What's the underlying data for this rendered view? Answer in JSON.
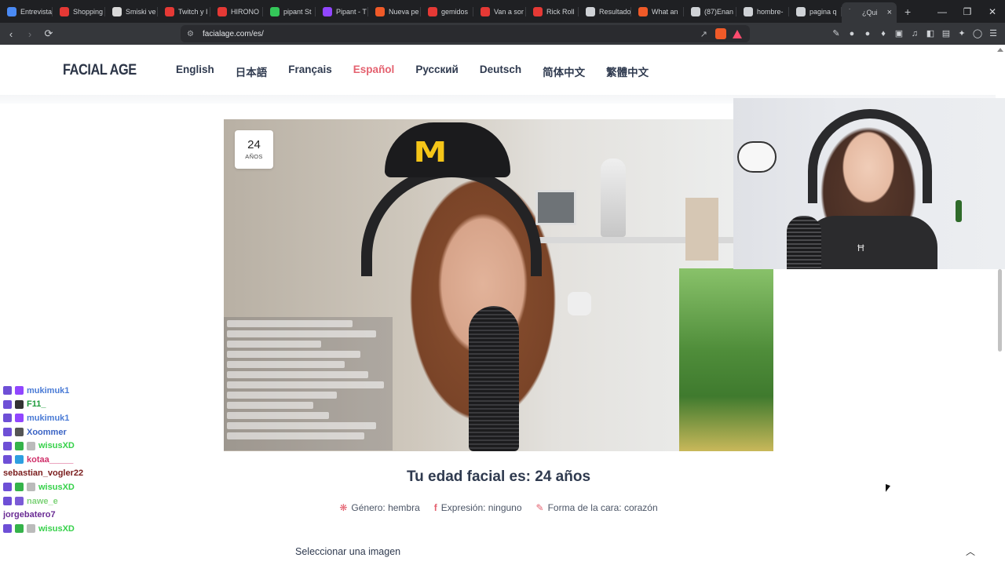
{
  "browser": {
    "tabs": [
      {
        "title": "Entrevista",
        "color": "#4a8af4"
      },
      {
        "title": "Shopping",
        "color": "#e53935"
      },
      {
        "title": "Smiski ve",
        "color": "#d9d9d9"
      },
      {
        "title": "Twitch y I",
        "color": "#e53935"
      },
      {
        "title": "HIRONO",
        "color": "#e53935"
      },
      {
        "title": "pipant St",
        "color": "#34c759"
      },
      {
        "title": "Pipant - T",
        "color": "#9146ff"
      },
      {
        "title": "Nueva pe",
        "color": "#f05a28"
      },
      {
        "title": "gemidos",
        "color": "#e53935"
      },
      {
        "title": "Van a sor",
        "color": "#e53935"
      },
      {
        "title": "Rick Roll",
        "color": "#e53935"
      },
      {
        "title": "Resultado",
        "color": "#cfd2d6"
      },
      {
        "title": "What an",
        "color": "#f05a28"
      },
      {
        "title": "(87)Enan",
        "color": "#cfd2d6"
      },
      {
        "title": "hombre-",
        "color": "#cfd2d6"
      },
      {
        "title": "pagina q",
        "color": "#cfd2d6"
      }
    ],
    "active_tab": {
      "title": "¿Qui",
      "close": "×"
    },
    "new_tab": "+",
    "url": "facialage.com/es/",
    "window_controls": {
      "minimize": "—",
      "maximize": "❐",
      "close": "✕"
    }
  },
  "site": {
    "logo": "FACIAL AGE",
    "languages": [
      "English",
      "日本語",
      "Français",
      "Español",
      "Русский",
      "Deutsch",
      "简体中文",
      "繁體中文"
    ],
    "current_language": "Español",
    "age_badge": {
      "value": "24",
      "unit": "AÑOS"
    },
    "result_title": "Tu edad facial es: 24 años",
    "meta": {
      "gender": "Género: hembra",
      "expression": "Expresión: ninguno",
      "face_shape": "Forma de la cara: corazón"
    },
    "upload_label": "Seleccionar una imagen",
    "back_to_top": "︿"
  },
  "stream_chat": [
    {
      "name": "mukimuk1",
      "color": "#4a7bd6",
      "badges": [
        "#6e4fd6",
        "#9146ff"
      ]
    },
    {
      "name": "F11_",
      "color": "#1c9a3a",
      "badges": [
        "#6e4fd6",
        "#333333"
      ]
    },
    {
      "name": "mukimuk1",
      "color": "#4a7bd6",
      "badges": [
        "#6e4fd6",
        "#9146ff"
      ]
    },
    {
      "name": "Xoommer",
      "color": "#3a63c4",
      "badges": [
        "#6e4fd6",
        "#555555"
      ]
    },
    {
      "name": "wisusXD",
      "color": "#36d14a",
      "badges": [
        "#6e4fd6",
        "#35b34a",
        "#bbbbbb"
      ]
    },
    {
      "name": "kotaa_____",
      "color": "#d0306a",
      "badges": [
        "#6e4fd6",
        "#2e9fe0"
      ]
    },
    {
      "name": "sebastian_vogler22",
      "color": "#7a1d1d",
      "badges": []
    },
    {
      "name": "wisusXD",
      "color": "#36d14a",
      "badges": [
        "#6e4fd6",
        "#35b34a",
        "#bbbbbb"
      ]
    },
    {
      "name": "nawe_e",
      "color": "#7fd37a",
      "badges": [
        "#6e4fd6",
        "#7b5bd6"
      ]
    },
    {
      "name": "jorgebatero7",
      "color": "#6a2b94",
      "badges": []
    },
    {
      "name": "wisusXD",
      "color": "#36d14a",
      "badges": [
        "#6e4fd6",
        "#35b34a",
        "#bbbbbb"
      ]
    }
  ]
}
